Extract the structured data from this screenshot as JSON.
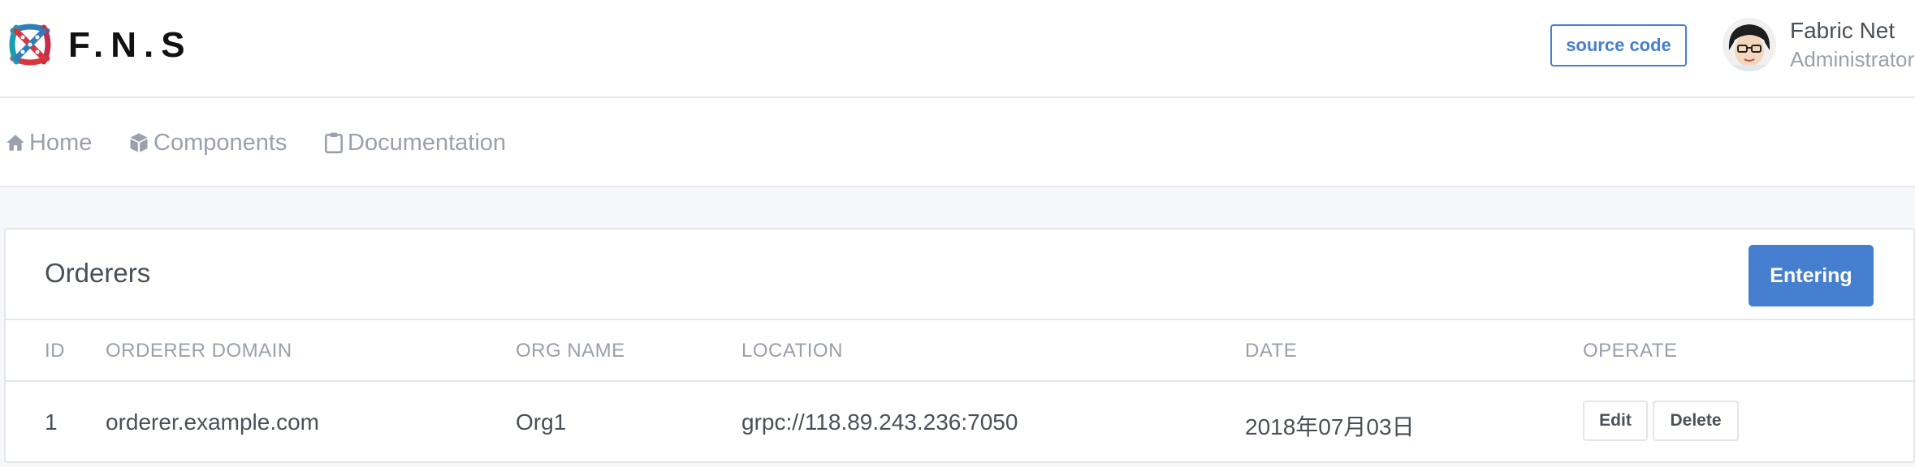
{
  "brand": {
    "name": "F.N.S"
  },
  "header": {
    "source_code_label": "source code",
    "user_name": "Fabric Net",
    "user_role": "Administrator"
  },
  "nav": {
    "items": [
      {
        "label": "Home",
        "icon": "home-icon"
      },
      {
        "label": "Components",
        "icon": "box-icon"
      },
      {
        "label": "Documentation",
        "icon": "clipboard-icon"
      }
    ]
  },
  "card": {
    "title": "Orderers",
    "action_label": "Entering"
  },
  "table": {
    "columns": [
      "ID",
      "ORDERER DOMAIN",
      "ORG NAME",
      "LOCATION",
      "DATE",
      "OPERATE"
    ],
    "rows": [
      {
        "id": "1",
        "domain": "orderer.example.com",
        "org": "Org1",
        "location": "grpc://118.89.243.236:7050",
        "date": "2018年07月03日",
        "edit_label": "Edit",
        "delete_label": "Delete"
      }
    ]
  },
  "colors": {
    "primary": "#467fcf",
    "muted": "#9aa0ac",
    "text": "#495057",
    "background": "#f5f7fb"
  }
}
